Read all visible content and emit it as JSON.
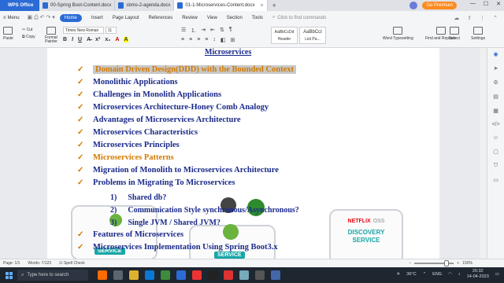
{
  "tabs": {
    "app": "WPS Office",
    "docs": [
      {
        "label": "00-Spring Boot-Content.docx",
        "active": false
      },
      {
        "label": "sbms-2-agenda.docx",
        "active": false
      },
      {
        "label": "01-1-Microservices-Content.docx",
        "active": true
      }
    ],
    "premium": "Go Premium"
  },
  "menubar": {
    "menu": "Menu",
    "items": [
      "Home",
      "Insert",
      "Page Layout",
      "References",
      "Review",
      "View",
      "Section",
      "Tools"
    ],
    "search": "Click to find commands"
  },
  "ribbon": {
    "paste": "Paste",
    "cut": "Cut",
    "copy": "Copy",
    "format_painter": "Format Painter",
    "font": "Times New Roman",
    "size": "11",
    "bold": "B",
    "italic": "I",
    "underline": "U",
    "style1_preview": "AaBbCcDd",
    "style1": "Header",
    "style2_preview": "AaBbCcI",
    "style2": "List Pa...",
    "word_typesetting": "Word Typesetting",
    "find_replace": "Find and Replace",
    "select": "Select",
    "settings": "Settings"
  },
  "document": {
    "heading": "Microservices",
    "bullets": [
      {
        "text": "Domain Driven Design(DDD) with the Bounded Context",
        "style": "highlight"
      },
      {
        "text": "Monolithic Applications",
        "style": "normal"
      },
      {
        "text": "Challenges in Monolith Applications",
        "style": "normal"
      },
      {
        "text": "Microservices Architecture-Honey Comb Analogy",
        "style": "normal"
      },
      {
        "text": "Advantages of Microservices Architecture",
        "style": "normal"
      },
      {
        "text": "Microservices Characteristics",
        "style": "normal"
      },
      {
        "text": "Microservices Principles",
        "style": "normal"
      },
      {
        "text": "Microservices Patterns",
        "style": "orange"
      },
      {
        "text": "Migration of Monolith to Microservices Architecture",
        "style": "normal"
      },
      {
        "text": "Problems in Migrating To Microservices",
        "style": "normal"
      }
    ],
    "sub_items": [
      {
        "num": "1)",
        "text": "Shared db?"
      },
      {
        "num": "2)",
        "text": "Communication Style synchronous/Asynchronous?"
      },
      {
        "num": "3)",
        "text": "Single JVM / Shared JVM?"
      }
    ],
    "bullets_after": [
      {
        "text": "Features of Microservices"
      },
      {
        "text": "Microservices Implementation Using Spring Boot3.x"
      }
    ],
    "diagram": {
      "netflix": "NETFLIX",
      "oss": "OSS",
      "discovery": "DISCOVERY",
      "service": "SERVICE",
      "left_label": "SERVICE",
      "mid_label": "SERVICE"
    }
  },
  "status": {
    "page": "Page: 1/1",
    "words": "Words: 7/123",
    "spell": "Spell Check",
    "zoom": "150%"
  },
  "taskbar": {
    "search": "Type here to search",
    "temp": "36°C",
    "lang": "ENG",
    "time": "20:32",
    "date": "14-04-2023"
  }
}
